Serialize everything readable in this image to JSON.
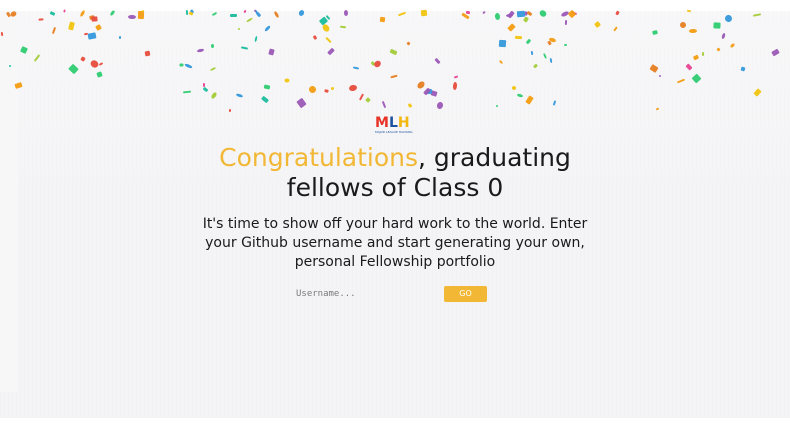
{
  "logo": {
    "letter_m": "M",
    "letter_l": "L",
    "letter_h": "H",
    "tagline": "MAJOR LEAGUE HACKING"
  },
  "headline": {
    "accent": "Congratulations",
    "rest_line_1": ", graduating",
    "line_2": "fellows of Class 0"
  },
  "subtext": "It's time to show off your hard work to the world. Enter your Github username and start generating your own, personal Fellowship portfolio",
  "search": {
    "placeholder": "Username...",
    "value": "",
    "go_label": "GO"
  },
  "colors": {
    "accent": "#f2b835",
    "text": "#1a1a1a",
    "background": "#f4f4f6",
    "mlh_red": "#e73427",
    "mlh_blue": "#1d539f",
    "mlh_yellow": "#f4b70f"
  }
}
